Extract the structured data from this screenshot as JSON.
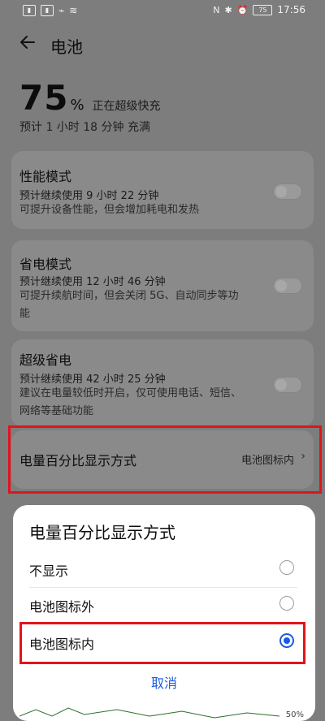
{
  "status_bar": {
    "left_icons": [
      "signal-icon",
      "signal-icon",
      "usb-icon",
      "wifi-icon"
    ],
    "right_icons": [
      "nfc-icon",
      "bluetooth-icon",
      "alarm-icon",
      "battery-icon"
    ],
    "battery_level": 75,
    "time": "17:56"
  },
  "header": {
    "title": "电池"
  },
  "battery": {
    "percent": "75",
    "percent_sign": "%",
    "state": "正在超级快充",
    "estimate": "预计 1 小时 18 分钟 充满"
  },
  "cards": [
    {
      "title": "性能模式",
      "subtitle": "预计继续使用 9 小时 22 分钟",
      "desc": "可提升设备性能，但会增加耗电和发热",
      "enabled": false
    },
    {
      "title": "省电模式",
      "subtitle": "预计继续使用 12 小时 46 分钟",
      "desc": "可提升续航时间，但会关闭 5G、自动同步等功能",
      "enabled": false
    },
    {
      "title": "超级省电",
      "subtitle": "预计继续使用 42 小时 25 分钟",
      "desc": "建议在电量较低时开启，仅可使用电话、短信、网络等基础功能",
      "enabled": false
    }
  ],
  "percent_display": {
    "label": "电量百分比显示方式",
    "value": "电池图标内",
    "chevron": "›"
  },
  "dialog": {
    "title": "电量百分比显示方式",
    "options": [
      {
        "label": "不显示",
        "selected": false
      },
      {
        "label": "电池图标外",
        "selected": false
      },
      {
        "label": "电池图标内",
        "selected": true
      }
    ],
    "cancel_label": "取消"
  },
  "background_peek": {
    "label_50": "50%"
  },
  "highlight_color": "#e3131b",
  "accent_color": "#1a59e6"
}
